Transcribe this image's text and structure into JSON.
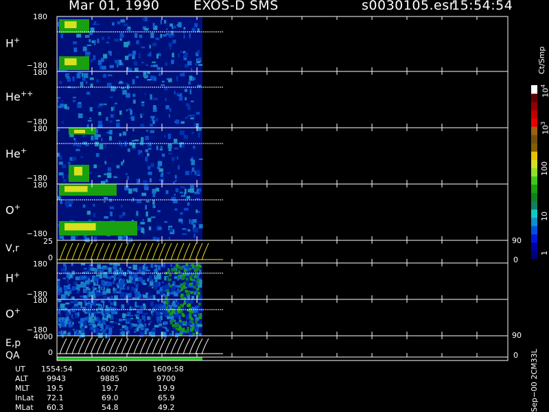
{
  "header": {
    "date": "Mar 01, 1990",
    "instrument": "EXOS-D SMS",
    "file": "s0030105.esr",
    "time": "15:54:54"
  },
  "panels": [
    {
      "species": "H",
      "charge": "+",
      "ymax": "180",
      "ymin": "−180"
    },
    {
      "species": "He",
      "charge": "++",
      "ymax": "180",
      "ymin": "−180"
    },
    {
      "species": "He",
      "charge": "+",
      "ymax": "180",
      "ymin": "−180"
    },
    {
      "species": "O",
      "charge": "+",
      "ymax": "180",
      "ymin": "−180"
    },
    {
      "species": "V,r",
      "charge": "",
      "ymax": "25",
      "ymin": "0",
      "rmax": "90",
      "rmin": "0"
    },
    {
      "species": "H",
      "charge": "+",
      "ymax": "180",
      "ymin": "−180"
    },
    {
      "species": "O",
      "charge": "+",
      "ymax": "180",
      "ymin": "−180"
    },
    {
      "species": "E,p",
      "charge": "",
      "ymax": "4000",
      "ymin": "0",
      "rmax": "90",
      "rmin": "0"
    }
  ],
  "qa_label": "QA",
  "colorbar": {
    "unit": "Ct/Smp",
    "ticks": [
      {
        "label": "1"
      },
      {
        "label": "10"
      },
      {
        "label": "100"
      },
      {
        "label": "10",
        "exp": "3"
      },
      {
        "label": "10",
        "exp": "4"
      }
    ],
    "colors": [
      "#00007a",
      "#0000a8",
      "#0018d8",
      "#0050e0",
      "#1090c8",
      "#10c8c8",
      "#108060",
      "#108020",
      "#18a010",
      "#40c818",
      "#90e028",
      "#d8e020",
      "#e8c000",
      "#806000",
      "#705010",
      "#a06010",
      "#e80000",
      "#c00000",
      "#900000",
      "#600000",
      "#ffffff"
    ]
  },
  "ephemeris": {
    "rows": [
      {
        "name": "UT",
        "values": [
          "1554:54",
          "1602:30",
          "1609:58"
        ]
      },
      {
        "name": "ALT",
        "values": [
          "9943",
          "9885",
          "9700"
        ]
      },
      {
        "name": "MLT",
        "values": [
          "19.5",
          "19.7",
          "19.9"
        ]
      },
      {
        "name": "InLat",
        "values": [
          "72.1",
          "69.0",
          "65.9"
        ]
      },
      {
        "name": "MLat",
        "values": [
          "60.3",
          "54.8",
          "49.2"
        ]
      }
    ]
  },
  "footer_vertical": "Sep−00 2CM33L"
}
